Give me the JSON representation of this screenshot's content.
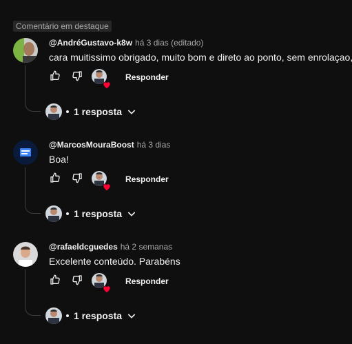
{
  "badge": "Comentário em destaque",
  "comments": [
    {
      "author": "@AndréGustavo-k8w",
      "time": "há 3 dias (editado)",
      "text": "cara muitissimo obrigado, muito bom e direto ao ponto, sem enrolaçao,",
      "reply_label": "Responder",
      "replies_count": "1 resposta",
      "avatar": "green-photo-avatar"
    },
    {
      "author": "@MarcosMouraBoost",
      "time": "há 3 dias",
      "text": "Boa!",
      "reply_label": "Responder",
      "replies_count": "1 resposta",
      "avatar": "boost-logo-avatar"
    },
    {
      "author": "@rafaeldcguedes",
      "time": "há 2 semanas",
      "text": "Excelente conteúdo. Parabéns",
      "reply_label": "Responder",
      "replies_count": "1 resposta",
      "avatar": "portrait-avatar"
    }
  ],
  "colors": {
    "background": "#0f0f0f",
    "heart": "#ff0033",
    "secondary_text": "#aaaaaa"
  }
}
